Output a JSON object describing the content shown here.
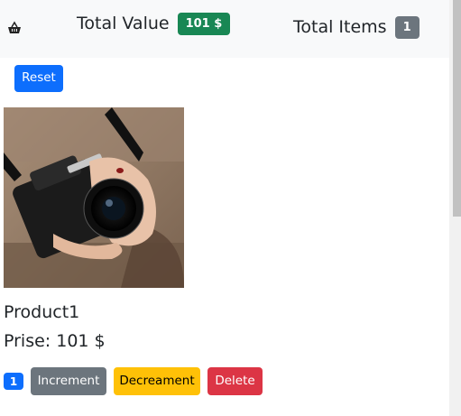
{
  "header": {
    "cart_icon": "shopping-basket-icon",
    "total_value_label": "Total Value",
    "total_value_badge": "101 $",
    "total_items_label": "Total Items",
    "total_items_badge": "1"
  },
  "toolbar": {
    "reset_label": "Reset"
  },
  "product": {
    "image_icon": "camera-photo",
    "name": "Product1",
    "price_text": "Prise: 101 $",
    "quantity": "1",
    "increment_label": "Increment",
    "decrement_label": "Decreament",
    "delete_label": "Delete"
  },
  "colors": {
    "navbar_bg": "#f8f9fa",
    "primary": "#0d6efd",
    "success": "#198754",
    "secondary": "#6c757d",
    "warning": "#ffc107",
    "danger": "#dc3545"
  }
}
